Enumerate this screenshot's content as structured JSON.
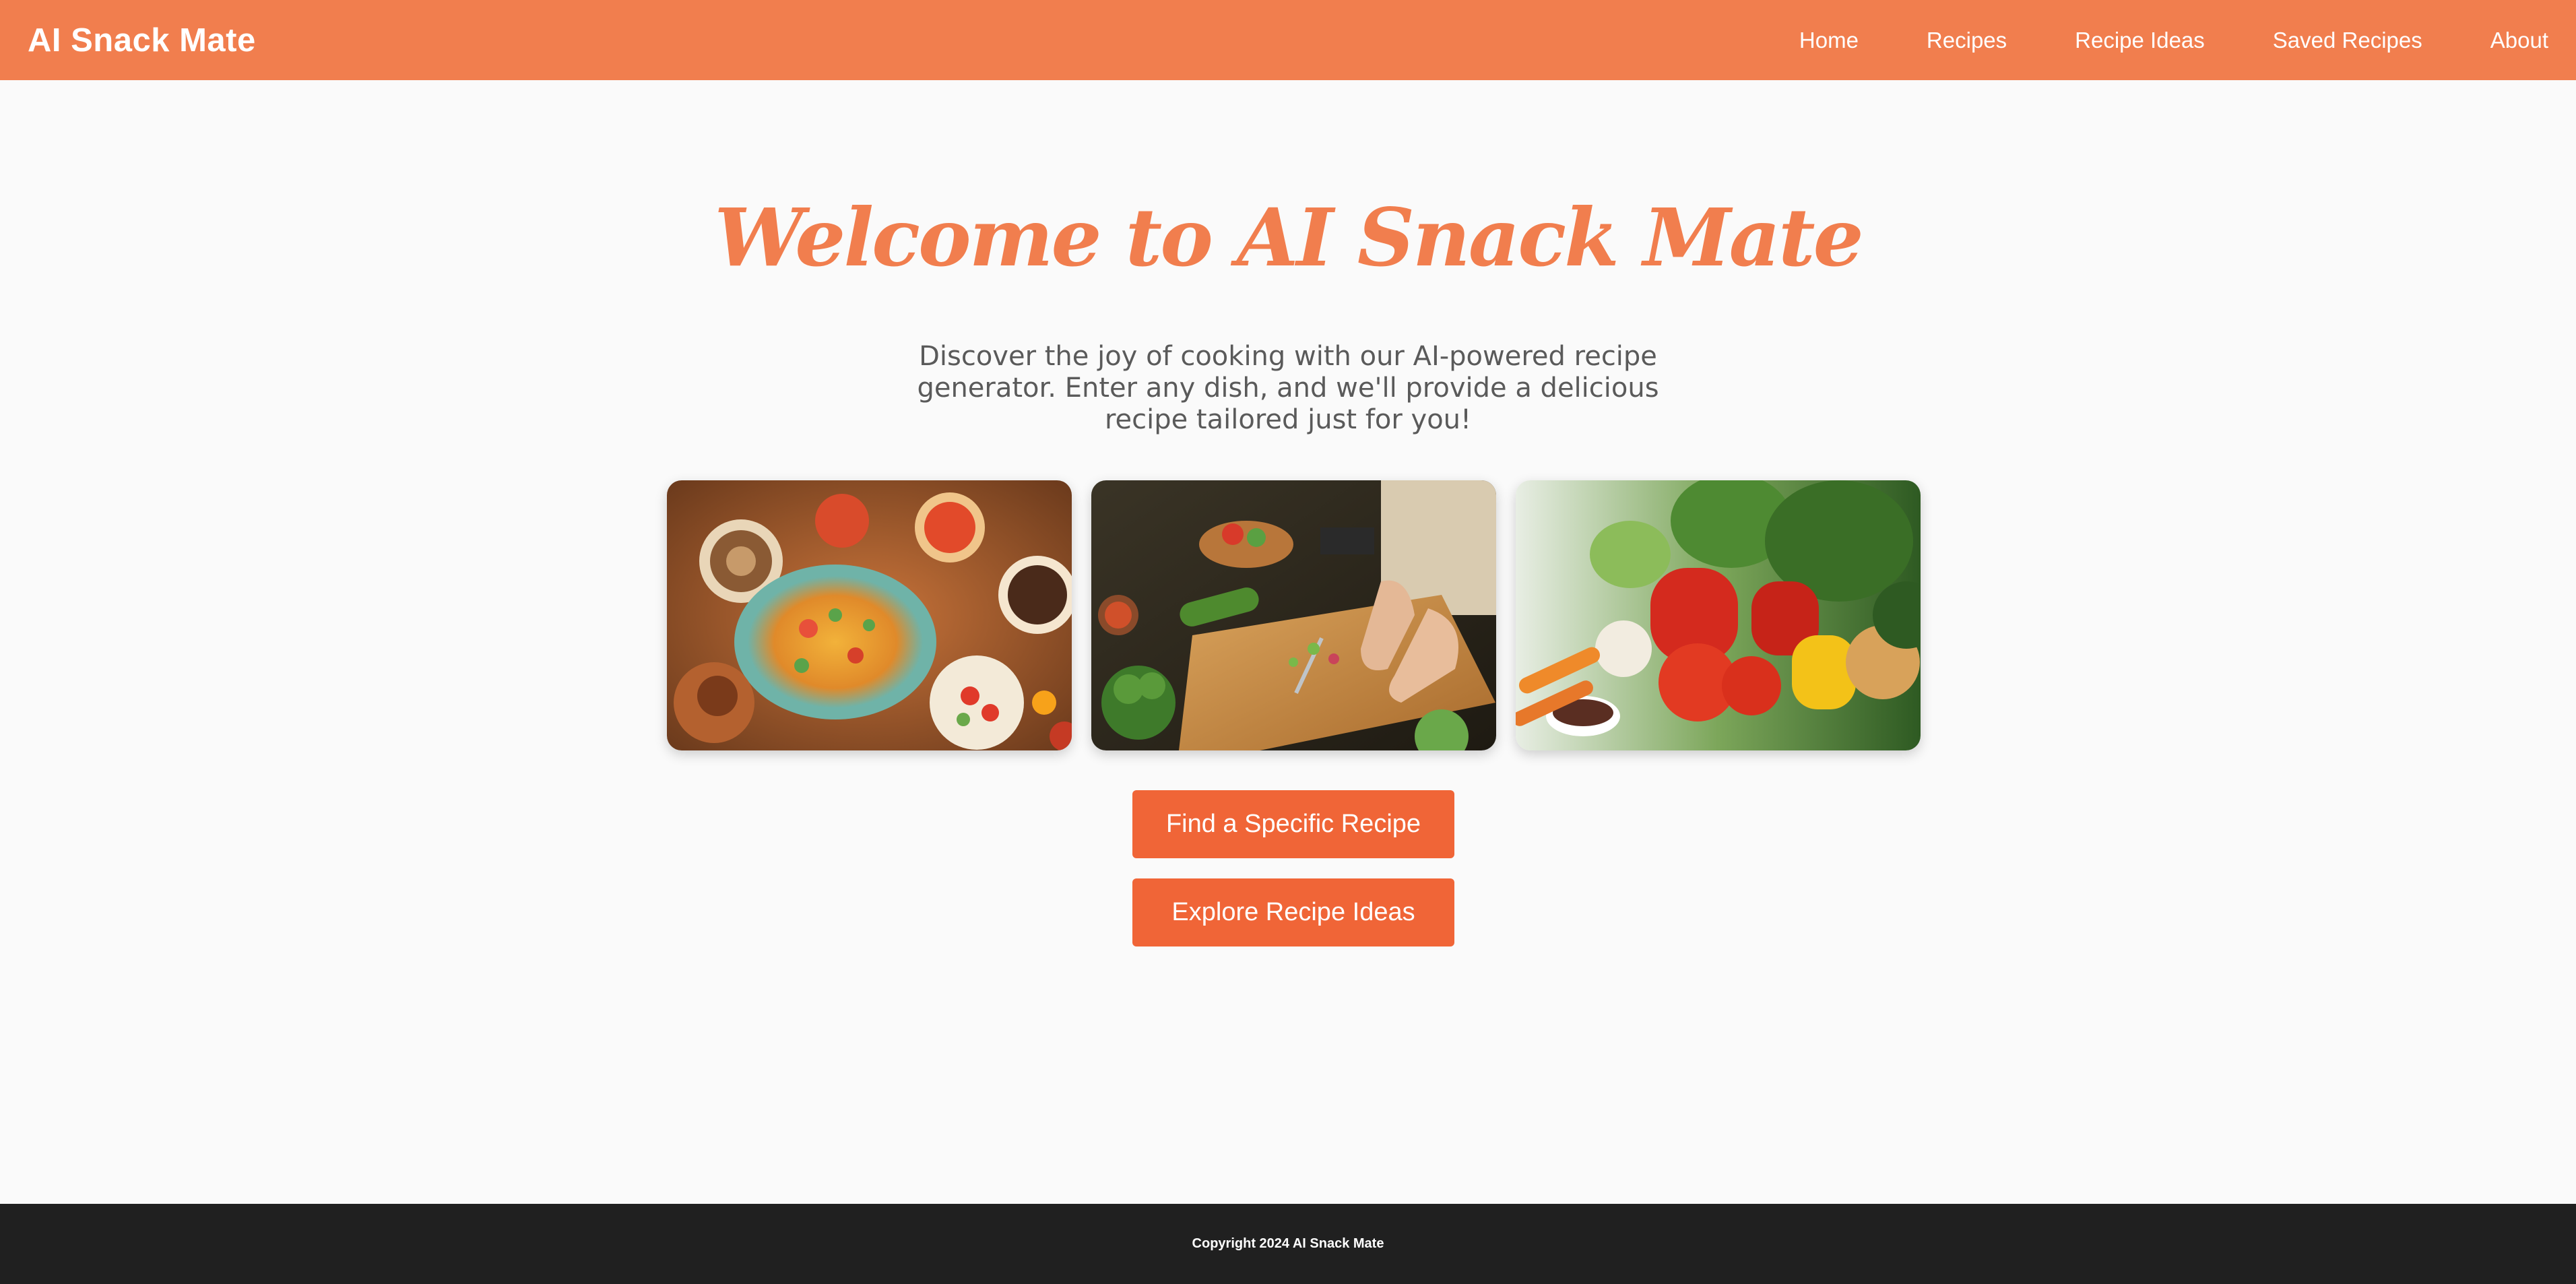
{
  "header": {
    "logo": "AI Snack Mate",
    "nav": [
      {
        "label": "Home"
      },
      {
        "label": "Recipes"
      },
      {
        "label": "Recipe Ideas"
      },
      {
        "label": "Saved Recipes"
      },
      {
        "label": "About"
      }
    ]
  },
  "hero": {
    "title": "Welcome to AI Snack Mate",
    "intro": "Discover the joy of cooking with our AI-powered recipe generator. Enter any dish, and we'll provide a delicious recipe tailored just for you!"
  },
  "gallery": {
    "images": [
      {
        "subject": "spread of prepared dishes"
      },
      {
        "subject": "hands chopping vegetables on cutting board"
      },
      {
        "subject": "fresh vegetables"
      }
    ]
  },
  "actions": {
    "find_label": "Find a Specific Recipe",
    "explore_label": "Explore Recipe Ideas"
  },
  "footer": {
    "copyright": "Copyright 2024 AI Snack Mate"
  },
  "colors": {
    "brand": "#f17e4e",
    "button": "#f06537",
    "footer_bg": "#202020",
    "page_bg": "#fafafa"
  }
}
